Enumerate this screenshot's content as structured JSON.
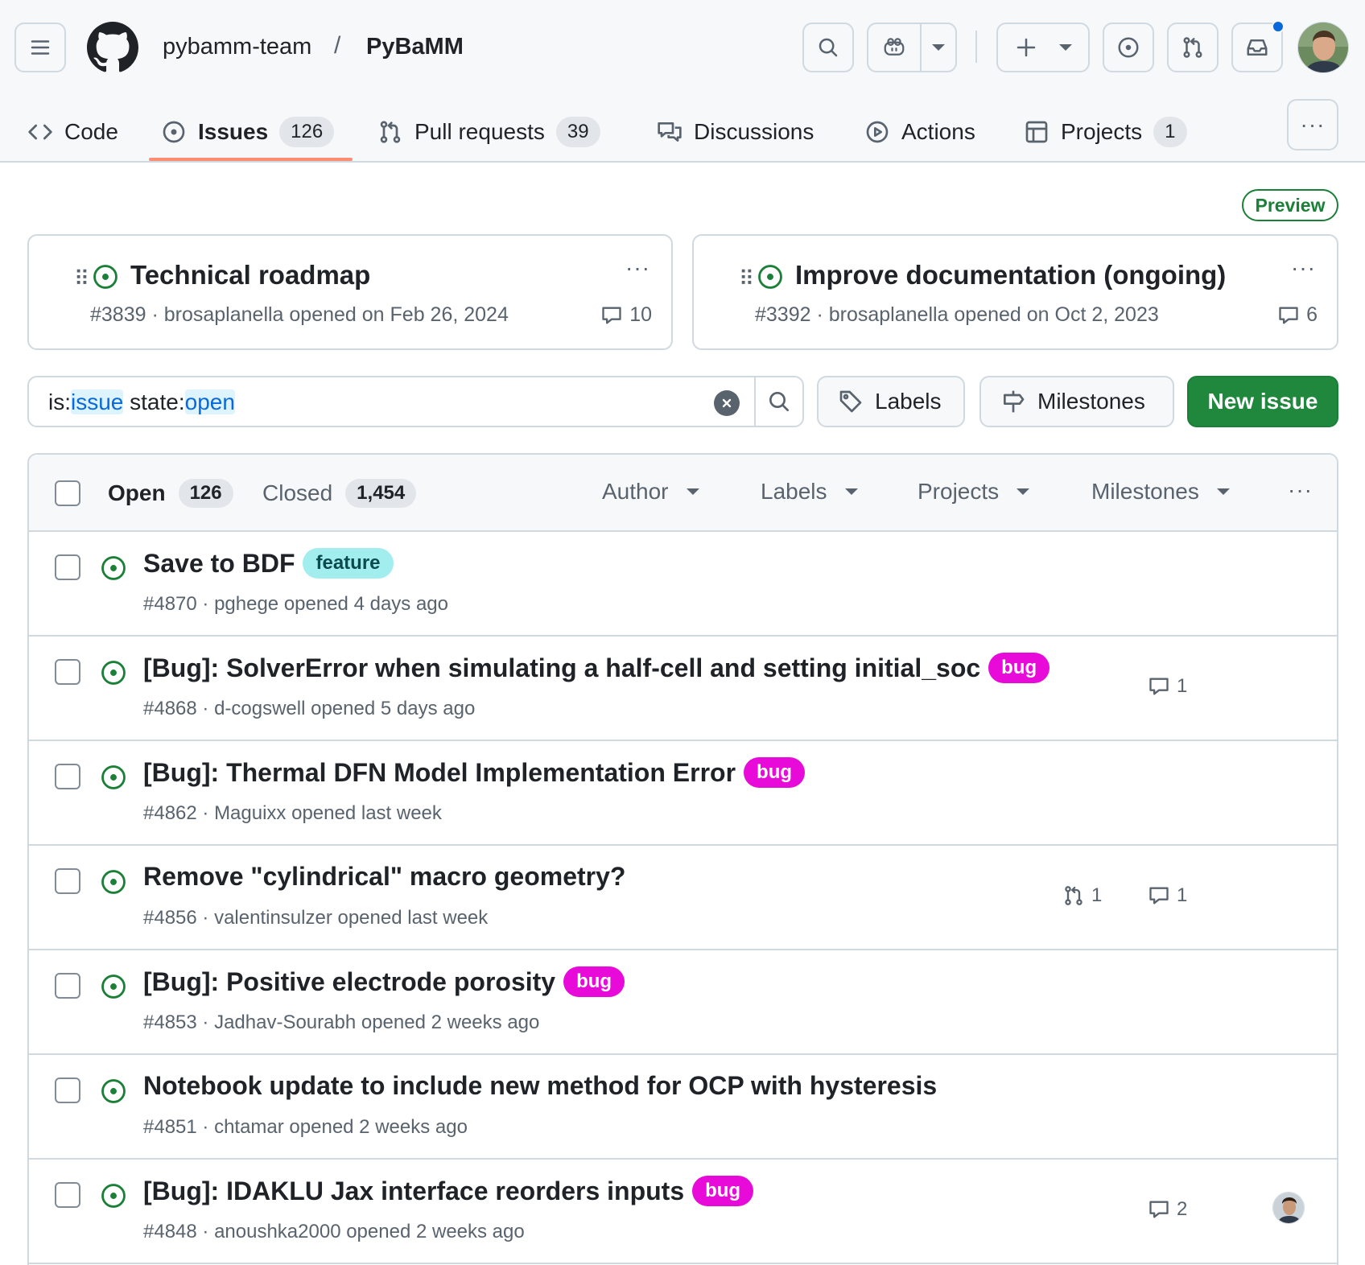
{
  "header": {
    "owner": "pybamm-team",
    "separator": "/",
    "repo": "PyBaMM"
  },
  "tabs": [
    {
      "label": "Code",
      "icon": "code-icon"
    },
    {
      "label": "Issues",
      "count": "126",
      "icon": "issue-opened-icon",
      "active": true
    },
    {
      "label": "Pull requests",
      "count": "39",
      "icon": "git-pull-request-icon"
    },
    {
      "label": "Discussions",
      "icon": "comment-discussion-icon"
    },
    {
      "label": "Actions",
      "icon": "play-icon"
    },
    {
      "label": "Projects",
      "count": "1",
      "icon": "table-icon"
    }
  ],
  "preview_badge": "Preview",
  "pinned": [
    {
      "title": "Technical roadmap",
      "meta": "#3839 · brosaplanella opened on Feb 26, 2024",
      "comments": "10"
    },
    {
      "title": "Improve documentation (ongoing)",
      "meta": "#3392 · brosaplanella opened on Oct 2, 2023",
      "comments": "6"
    }
  ],
  "search": {
    "q1": "is:",
    "q2": "issue",
    "q3": " state:",
    "q4": "open"
  },
  "filters": {
    "labels": "Labels",
    "milestones": "Milestones",
    "new_issue": "New issue"
  },
  "list_header": {
    "open_label": "Open",
    "open_count": "126",
    "closed_label": "Closed",
    "closed_count": "1,454",
    "author": "Author",
    "labels": "Labels",
    "projects": "Projects",
    "milestones": "Milestones"
  },
  "issues": [
    {
      "title": "Save to BDF",
      "label": "feature",
      "meta": "#4870 · pghege opened 4 days ago"
    },
    {
      "title": "[Bug]: SolverError when simulating a half-cell and setting initial_soc",
      "label": "bug",
      "meta": "#4868 · d-cogswell opened 5 days ago",
      "comments": "1"
    },
    {
      "title": "[Bug]: Thermal DFN Model Implementation Error",
      "label": "bug",
      "meta": "#4862 · Maguixx opened last week"
    },
    {
      "title": "Remove \"cylindrical\" macro geometry?",
      "meta": "#4856 · valentinsulzer opened last week",
      "prs": "1",
      "comments": "1"
    },
    {
      "title": "[Bug]: Positive electrode porosity",
      "label": "bug",
      "meta": "#4853 · Jadhav-Sourabh opened 2 weeks ago"
    },
    {
      "title": "Notebook update to include new method for OCP with hysteresis",
      "meta": "#4851 · chtamar opened 2 weeks ago"
    },
    {
      "title": "[Bug]: IDAKLU Jax interface reorders inputs",
      "label": "bug",
      "meta": "#4848 · anoushka2000 opened 2 weeks ago",
      "comments": "2"
    }
  ],
  "colors": {
    "open_green": "#1a7f37",
    "new_issue_green": "#1f883d",
    "bug_label": "#e70ad9",
    "feature_label": "#a2eeef",
    "tab_underline": "#fd8c73",
    "notification_dot": "#0969da"
  }
}
